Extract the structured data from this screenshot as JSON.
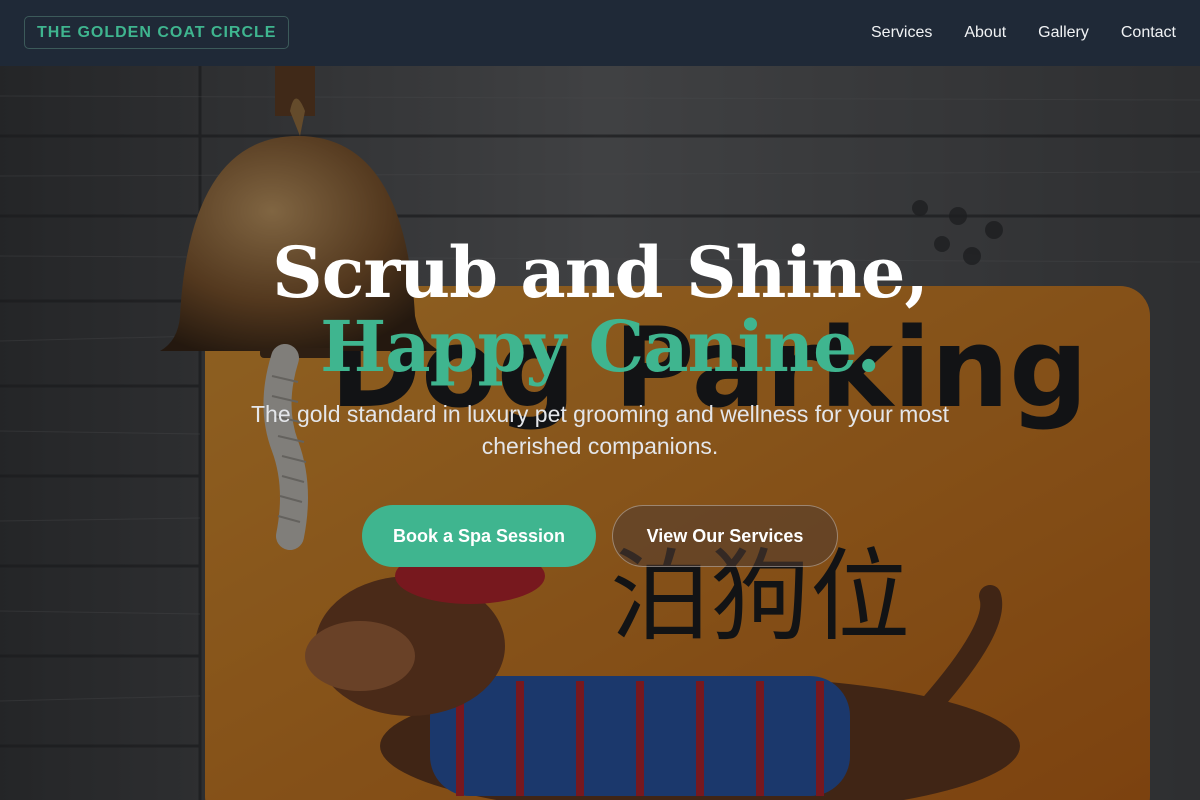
{
  "brand": {
    "name": "THE GOLDEN COAT CIRCLE"
  },
  "nav": {
    "items": [
      "Services",
      "About",
      "Gallery",
      "Contact"
    ]
  },
  "hero": {
    "headline_line1": "Scrub and Shine,",
    "headline_line2": "Happy Canine.",
    "subtitle": "The gold standard in luxury pet grooming and wellness for your most cherished companions.",
    "primary_button": "Book a Spa Session",
    "secondary_button": "View Our Services",
    "background_sign": {
      "title_text": "Dog Parking",
      "chinese_text": "泊狗位"
    }
  },
  "colors": {
    "accent": "#3fb58f",
    "nav_background": "#1f2937",
    "sign_orange": "#e88a1a",
    "wood": "#5a5a5a"
  },
  "icons": {
    "bell": "brass-bell-icon"
  }
}
